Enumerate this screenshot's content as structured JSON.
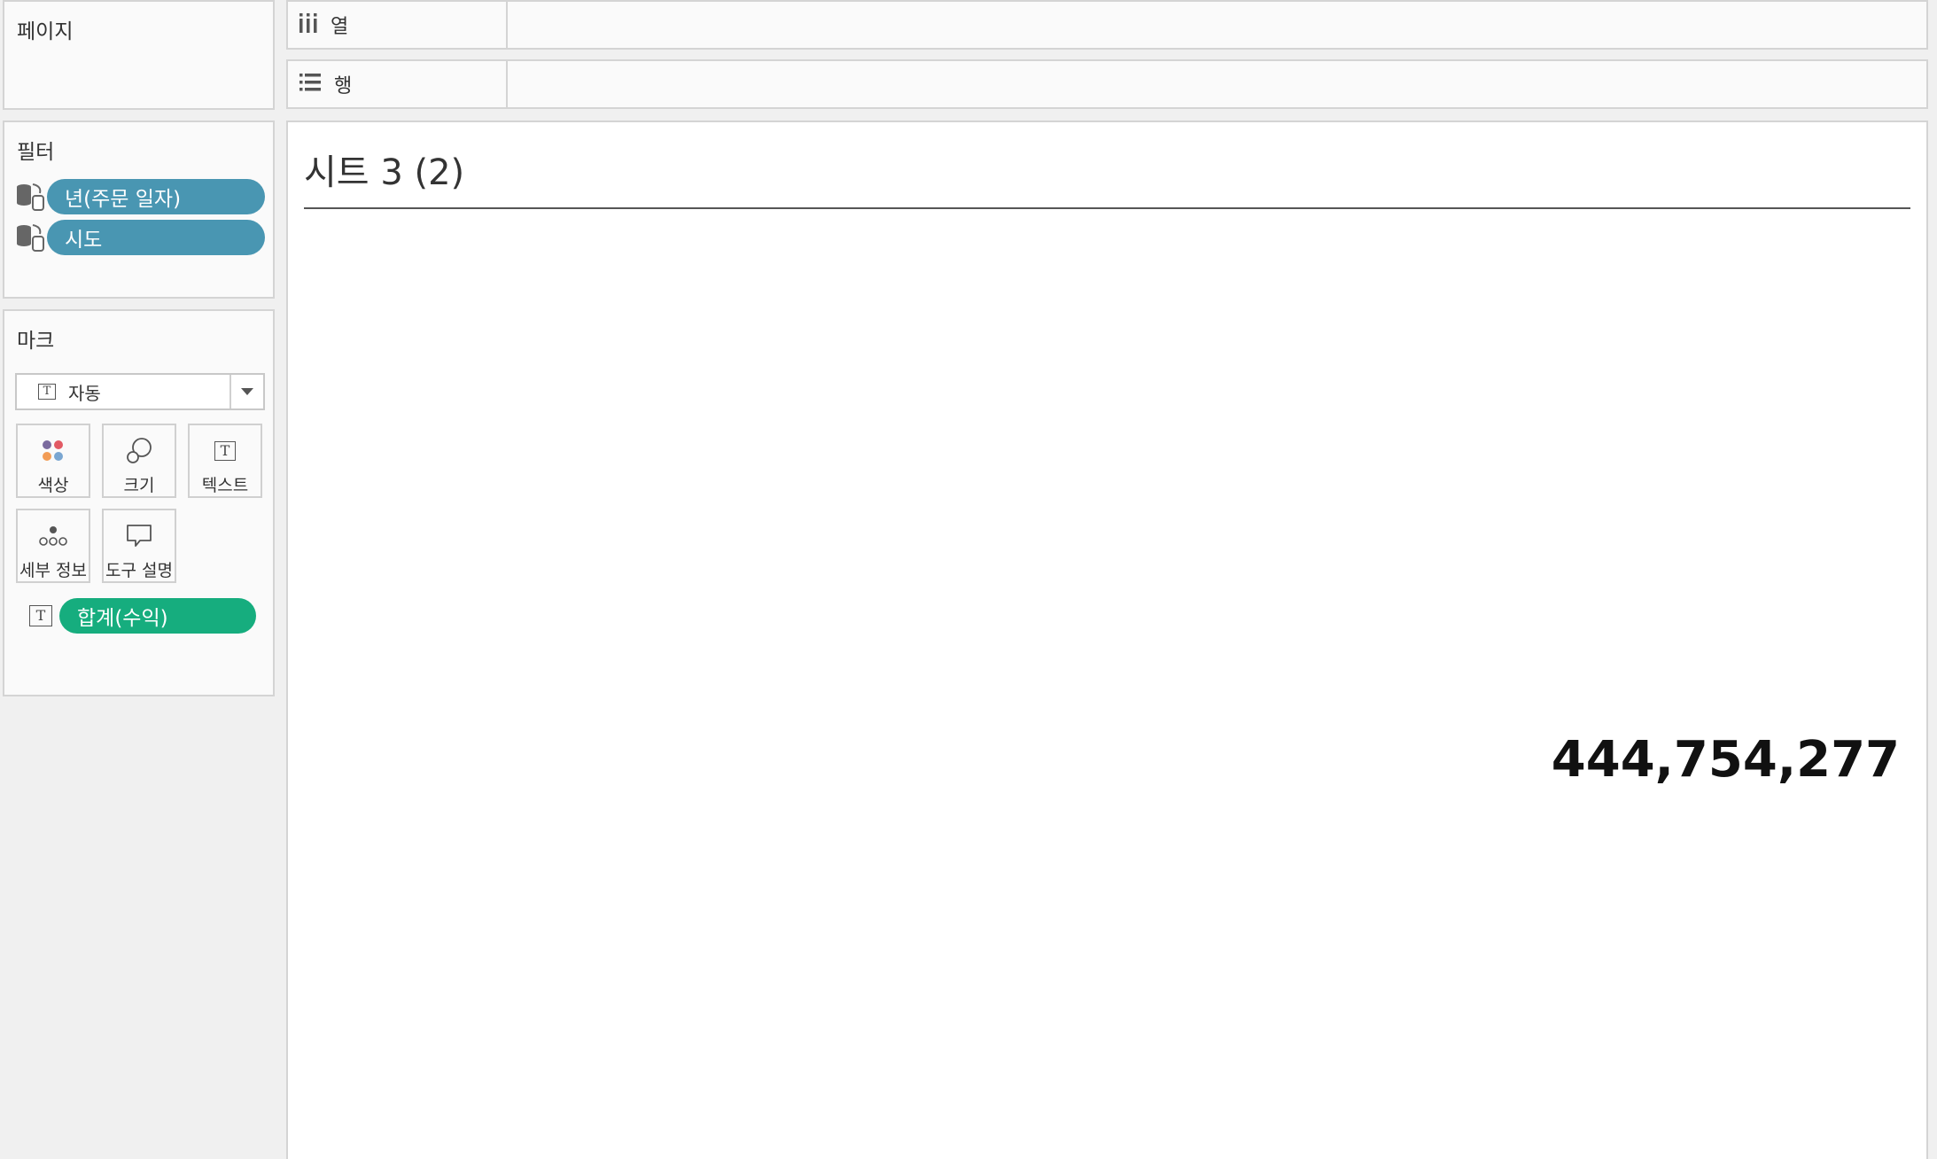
{
  "pages": {
    "title": "페이지"
  },
  "filters": {
    "title": "필터",
    "items": [
      {
        "label": "년(주문 일자)"
      },
      {
        "label": "시도"
      }
    ]
  },
  "marks": {
    "title": "마크",
    "type_selected": "자동",
    "buttons": {
      "color": "색상",
      "size": "크기",
      "text": "텍스트",
      "detail": "세부 정보",
      "tooltip": "도구 설명"
    },
    "encodings": [
      {
        "label": "합계(수익)"
      }
    ]
  },
  "shelves": {
    "columns": "열",
    "rows": "행"
  },
  "view": {
    "title": "시트 3 (2)",
    "value": "444,754,277"
  },
  "colors": {
    "filter_pill": "#4996b2",
    "measure_pill": "#16ad7e"
  }
}
